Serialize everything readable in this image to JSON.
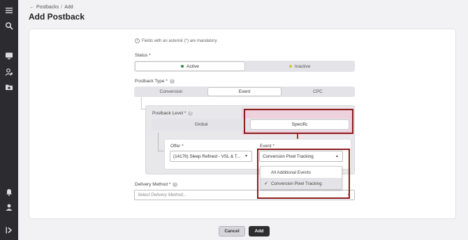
{
  "nav": {
    "icons": [
      "menu-icon",
      "search-icon",
      "monitor-icon",
      "user-settings-icon",
      "folder-icon",
      "bell-icon",
      "user-icon",
      "expand-icon"
    ]
  },
  "header": {
    "breadcrumb_root": "Postbacks",
    "breadcrumb_sep": "/",
    "breadcrumb_current": "Add",
    "title": "Add Postback"
  },
  "form": {
    "mandatory_note": "Fields with an asterisk (*) are mandatory.",
    "status": {
      "label": "Status *",
      "options": [
        {
          "label": "Active",
          "dot_color": "#2e8b3a",
          "selected": true
        },
        {
          "label": "Inactive",
          "dot_color": "#c8cc3a",
          "selected": false
        }
      ]
    },
    "postback_type": {
      "label": "Postback Type *",
      "options": [
        {
          "label": "Conversion",
          "selected": false
        },
        {
          "label": "Event",
          "selected": true
        },
        {
          "label": "CPC",
          "selected": false
        }
      ]
    },
    "postback_level": {
      "label": "Postback Level *",
      "options": [
        {
          "label": "Global",
          "selected": false
        },
        {
          "label": "Specific",
          "selected": true
        }
      ]
    },
    "offer": {
      "label": "Offer *",
      "value": "(14176) Sleep Refined - VSL & T..."
    },
    "event": {
      "label": "Event *",
      "value": "Conversion Pixel Tracking",
      "dropdown": [
        {
          "label": "All Additional Events",
          "selected": false
        },
        {
          "label": "Conversion Pixel Tracking",
          "selected": true
        }
      ]
    },
    "delivery_method": {
      "label": "Delivery Method *",
      "placeholder": "Select Delivery Method..."
    }
  },
  "actions": {
    "cancel": "Cancel",
    "add": "Add"
  },
  "colors": {
    "rail": "#2c2c30",
    "highlight_box": "#8b1c1c",
    "highlight_fill": "#f0bed2",
    "primary_button": "#2d2d2f"
  }
}
